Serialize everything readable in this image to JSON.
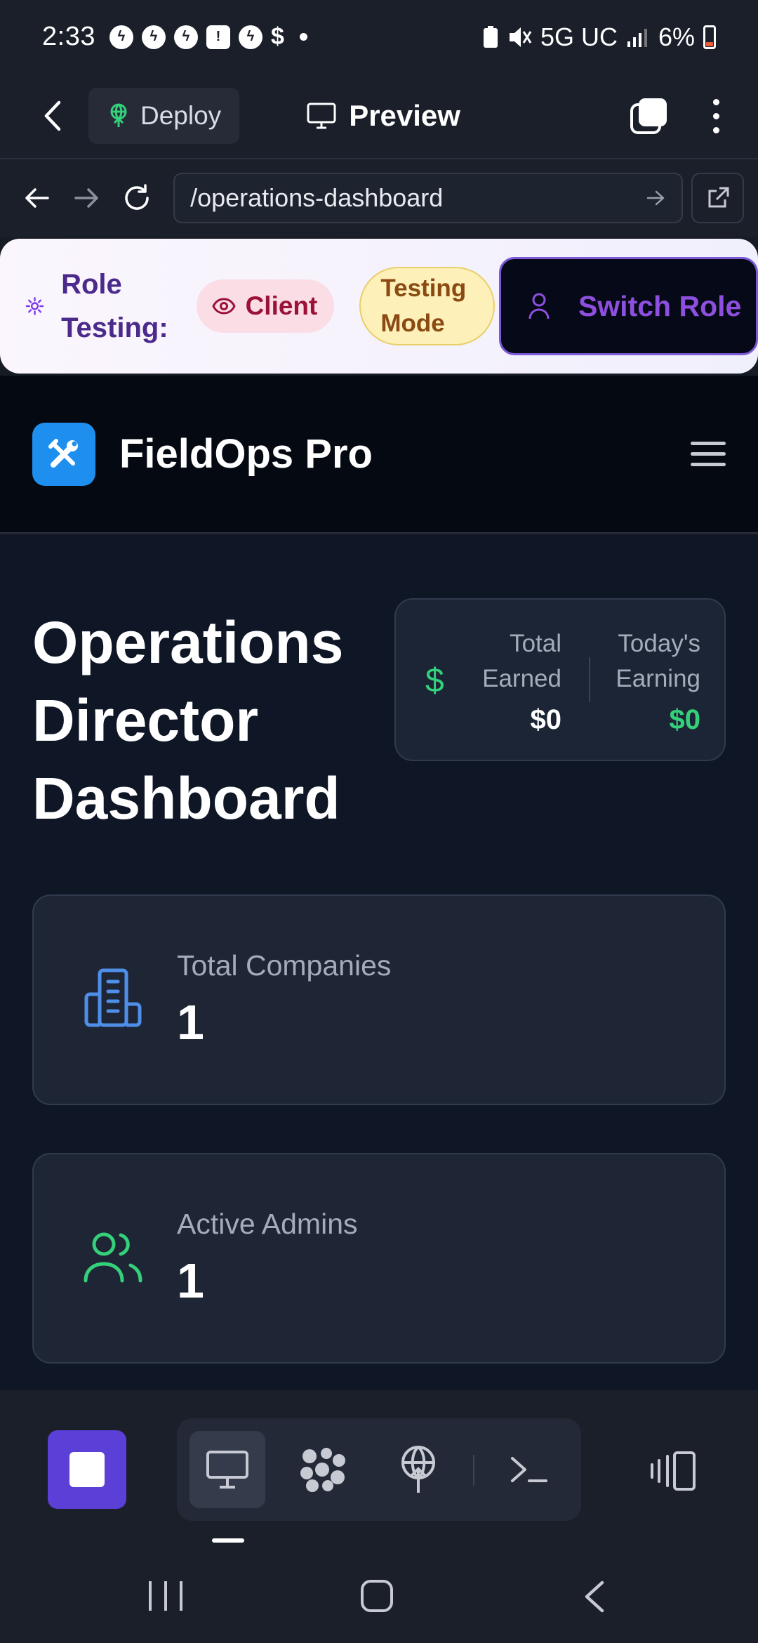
{
  "status_bar": {
    "time": "2:33",
    "network": "5G UC",
    "battery_percent": "6%",
    "notification_icons": [
      "messenger-icon",
      "messenger-icon",
      "messenger-icon",
      "alert-icon",
      "messenger-icon",
      "dollar-icon"
    ]
  },
  "app_header": {
    "deploy_label": "Deploy",
    "preview_label": "Preview"
  },
  "url_bar": {
    "path": "/operations-dashboard"
  },
  "role_banner": {
    "label": "Role Testing:",
    "current_role": "Client",
    "mode_badge": "Testing Mode",
    "switch_label": "Switch Role"
  },
  "site_nav": {
    "brand": "FieldOps Pro"
  },
  "dashboard": {
    "title": "Operations Director Dashboard",
    "earnings": {
      "total_label": "Total Earned",
      "total_value": "$0",
      "today_label": "Today's Earning",
      "today_value": "$0",
      "currency_symbol": "$"
    },
    "stats": [
      {
        "label": "Total Companies",
        "value": "1",
        "icon": "building-icon",
        "color": "#4f8fea"
      },
      {
        "label": "Active Admins",
        "value": "1",
        "icon": "users-icon",
        "color": "#34d17a"
      }
    ]
  },
  "toolbar": {
    "tools": [
      "preview-icon",
      "agent-icon",
      "deploy-icon",
      "terminal-icon"
    ],
    "active_tool": "preview-icon"
  },
  "colors": {
    "accent_purple": "#5b3fd6",
    "brand_blue": "#1e8fee",
    "success_green": "#34d17a",
    "background": "#0f1625"
  }
}
